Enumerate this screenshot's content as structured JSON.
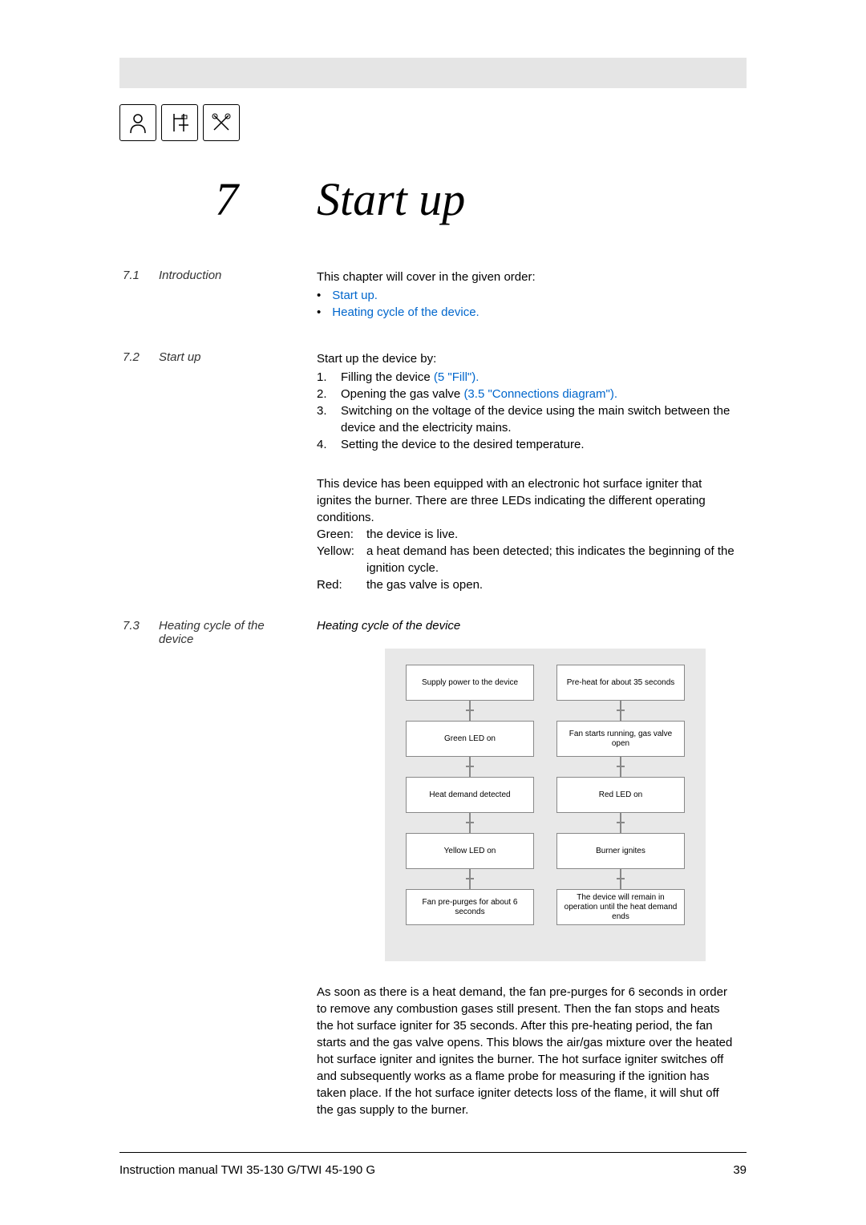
{
  "chapter": {
    "number": "7",
    "title": "Start up"
  },
  "sections": {
    "s71": {
      "num": "7.1",
      "label": "Introduction",
      "intro": "This chapter will cover in the given order:",
      "bullets": [
        "Start up.",
        "Heating cycle of the device."
      ]
    },
    "s72": {
      "num": "7.2",
      "label": "Start up",
      "intro": "Start up the device by:",
      "steps": [
        {
          "n": "1.",
          "text_a": "Filling the device ",
          "link": "(5 \"Fill\").",
          "text_b": ""
        },
        {
          "n": "2.",
          "text_a": "Opening the gas valve ",
          "link": "(3.5 \"Connections diagram\").",
          "text_b": ""
        },
        {
          "n": "3.",
          "text_a": "Switching on the voltage of the device using the main switch between the device and the electricity mains.",
          "link": "",
          "text_b": ""
        },
        {
          "n": "4.",
          "text_a": "Setting the device to the desired temperature.",
          "link": "",
          "text_b": ""
        }
      ],
      "para2": "This device has been equipped with an electronic hot surface igniter that ignites the burner. There are three LEDs indicating the different operating conditions.",
      "leds": [
        {
          "label": "Green:",
          "desc": "the device is live."
        },
        {
          "label": "Yellow:",
          "desc": "a heat demand has been detected; this indicates the beginning of the ignition cycle."
        },
        {
          "label": "Red:",
          "desc": "the gas valve is open."
        }
      ]
    },
    "s73": {
      "num": "7.3",
      "label": "Heating cycle of the device",
      "caption": "Heating cycle of the device",
      "flow_left": [
        "Supply power to the device",
        "Green LED on",
        "Heat demand detected",
        "Yellow LED on",
        "Fan pre-purges for about 6 seconds"
      ],
      "flow_right": [
        "Pre-heat for about 35 seconds",
        "Fan starts running, gas valve open",
        "Red LED on",
        "Burner ignites",
        "The device will remain in operation until the heat demand ends"
      ],
      "para": "As soon as there is a heat demand, the fan pre-purges for 6 seconds in order to remove any combustion gases still present. Then the fan stops and heats the hot surface igniter for 35 seconds. After this pre-heating period, the fan starts and the gas valve opens. This blows the air/gas mixture over the heated hot surface igniter and ignites the burner. The hot surface igniter switches off and subsequently works as a ﬂame probe for measuring if the ignition has taken place. If the hot surface igniter detects loss of the ﬂame, it will shut off the gas supply to the burner."
    }
  },
  "footer": {
    "text": "Instruction manual TWI 35-130 G/TWI 45-190 G",
    "page": "39"
  },
  "chart_data": {
    "type": "flowchart",
    "columns": [
      {
        "name": "left",
        "steps": [
          "Supply power to the device",
          "Green LED on",
          "Heat demand detected",
          "Yellow LED on",
          "Fan pre-purges for about 6 seconds"
        ]
      },
      {
        "name": "right",
        "steps": [
          "Pre-heat for about 35 seconds",
          "Fan starts running, gas valve open",
          "Red LED on",
          "Burner ignites",
          "The device will remain in operation until the heat demand ends"
        ]
      }
    ],
    "title": "Heating cycle of the device"
  }
}
